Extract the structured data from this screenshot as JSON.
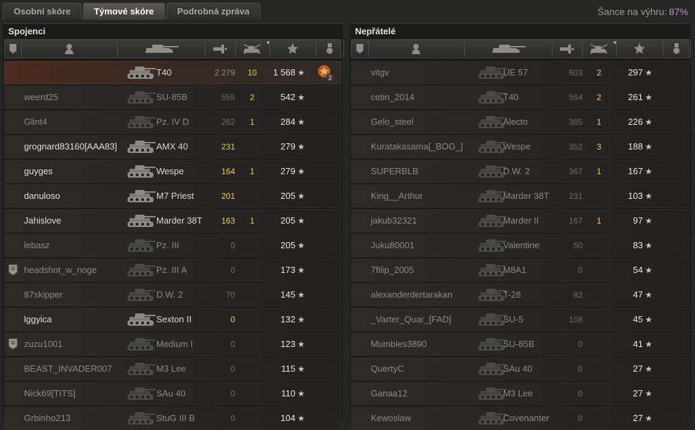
{
  "tabs": [
    "Osobní skóre",
    "Týmové skóre",
    "Podrobná zpráva"
  ],
  "active_tab": 1,
  "chance": {
    "label": "Šance na výhru:",
    "value": "87%"
  },
  "allies": {
    "title": "Spojenci",
    "rows": [
      {
        "player": "",
        "tank": "T40",
        "dmg": "2 279",
        "kills": "10",
        "xp": "1 568",
        "medal": "2",
        "state": "self"
      },
      {
        "player": "weerd25",
        "tank": "SU-85B",
        "dmg": "555",
        "kills": "2",
        "xp": "542",
        "state": "dead"
      },
      {
        "player": "Glint4",
        "tank": "Pz. IV D",
        "dmg": "262",
        "kills": "1",
        "xp": "284",
        "state": "dead"
      },
      {
        "player": "grognard83160[AAA83]",
        "tank": "AMX 40",
        "dmg": "231",
        "kills": "",
        "xp": "279",
        "state": "alive"
      },
      {
        "player": "guyges",
        "tank": "Wespe",
        "dmg": "164",
        "kills": "1",
        "xp": "279",
        "state": "alive"
      },
      {
        "player": "danuloso",
        "tank": "M7 Priest",
        "dmg": "201",
        "kills": "",
        "xp": "205",
        "state": "alive"
      },
      {
        "player": "Jahislove",
        "tank": "Marder 38T",
        "dmg": "163",
        "kills": "1",
        "xp": "205",
        "state": "alive"
      },
      {
        "player": "lebasz",
        "tank": "Pz. III",
        "dmg": "0",
        "kills": "",
        "xp": "205",
        "state": "dead"
      },
      {
        "player": "headshot_w_noge",
        "tank": "Pz. III A",
        "dmg": "0",
        "kills": "",
        "xp": "173",
        "state": "dead",
        "badge": true
      },
      {
        "player": "87skipper",
        "tank": "D.W. 2",
        "dmg": "70",
        "kills": "",
        "xp": "145",
        "state": "dead"
      },
      {
        "player": "lggyica",
        "tank": "Sexton II",
        "dmg": "0",
        "kills": "",
        "xp": "132",
        "state": "alive"
      },
      {
        "player": "zuzu1001",
        "tank": "Medium I",
        "dmg": "0",
        "kills": "",
        "xp": "123",
        "state": "dead",
        "badge": true
      },
      {
        "player": "BEAST_INVADER007",
        "tank": "M3 Lee",
        "dmg": "0",
        "kills": "",
        "xp": "115",
        "state": "dead"
      },
      {
        "player": "Nick69[TITS]",
        "tank": "SAu 40",
        "dmg": "0",
        "kills": "",
        "xp": "110",
        "state": "dead"
      },
      {
        "player": "Grbinho213",
        "tank": "StuG III B",
        "dmg": "0",
        "kills": "",
        "xp": "104",
        "state": "dead"
      }
    ]
  },
  "enemies": {
    "title": "Nepřátelé",
    "rows": [
      {
        "player": "vitgv",
        "tank": "UE 57",
        "dmg": "603",
        "kills": "2",
        "xp": "297",
        "state": "dead"
      },
      {
        "player": "cetin_2014",
        "tank": "T40",
        "dmg": "564",
        "kills": "2",
        "xp": "261",
        "state": "dead"
      },
      {
        "player": "Gelo_steel",
        "tank": "Alecto",
        "dmg": "385",
        "kills": "1",
        "xp": "226",
        "state": "dead"
      },
      {
        "player": "Kuratakasama[_BOG_]",
        "tank": "Wespe",
        "dmg": "352",
        "kills": "3",
        "xp": "188",
        "state": "dead"
      },
      {
        "player": "SUPERBLB",
        "tank": "D.W. 2",
        "dmg": "367",
        "kills": "1",
        "xp": "167",
        "state": "dead"
      },
      {
        "player": "King__Arthur",
        "tank": "Marder 38T",
        "dmg": "231",
        "kills": "",
        "xp": "103",
        "state": "dead"
      },
      {
        "player": "jakub32321",
        "tank": "Marder II",
        "dmg": "167",
        "kills": "1",
        "xp": "97",
        "state": "dead"
      },
      {
        "player": "Juku80001",
        "tank": "Valentine",
        "dmg": "50",
        "kills": "",
        "xp": "83",
        "state": "dead"
      },
      {
        "player": "7filip_2005",
        "tank": "M8A1",
        "dmg": "0",
        "kills": "",
        "xp": "54",
        "state": "dead"
      },
      {
        "player": "alexanderdertarakan",
        "tank": "T-28",
        "dmg": "82",
        "kills": "",
        "xp": "47",
        "state": "dead"
      },
      {
        "player": "_Varter_Quar_[FAD]",
        "tank": "SU-5",
        "dmg": "108",
        "kills": "",
        "xp": "45",
        "state": "dead"
      },
      {
        "player": "Mumbles3890",
        "tank": "SU-85B",
        "dmg": "0",
        "kills": "",
        "xp": "41",
        "state": "dead"
      },
      {
        "player": "QuertyC",
        "tank": "SAu 40",
        "dmg": "0",
        "kills": "",
        "xp": "27",
        "state": "dead"
      },
      {
        "player": "Ganaa12",
        "tank": "M3 Lee",
        "dmg": "0",
        "kills": "",
        "xp": "27",
        "state": "dead"
      },
      {
        "player": "Kewoslaw",
        "tank": "Covenanter",
        "dmg": "0",
        "kills": "",
        "xp": "27",
        "state": "dead"
      }
    ]
  },
  "icons": {
    "columns": [
      "badge-icon",
      "player-icon",
      "tank-icon",
      "damage-icon",
      "kills-icon",
      "experience-star-icon",
      "medal-icon"
    ],
    "colors": {
      "self_dmg": "#8d8a82",
      "alive_dmg": "#e8cf55",
      "dead_dmg": "#6f6d67",
      "kills": "#e8cf55",
      "chance": "#c487d7"
    }
  }
}
